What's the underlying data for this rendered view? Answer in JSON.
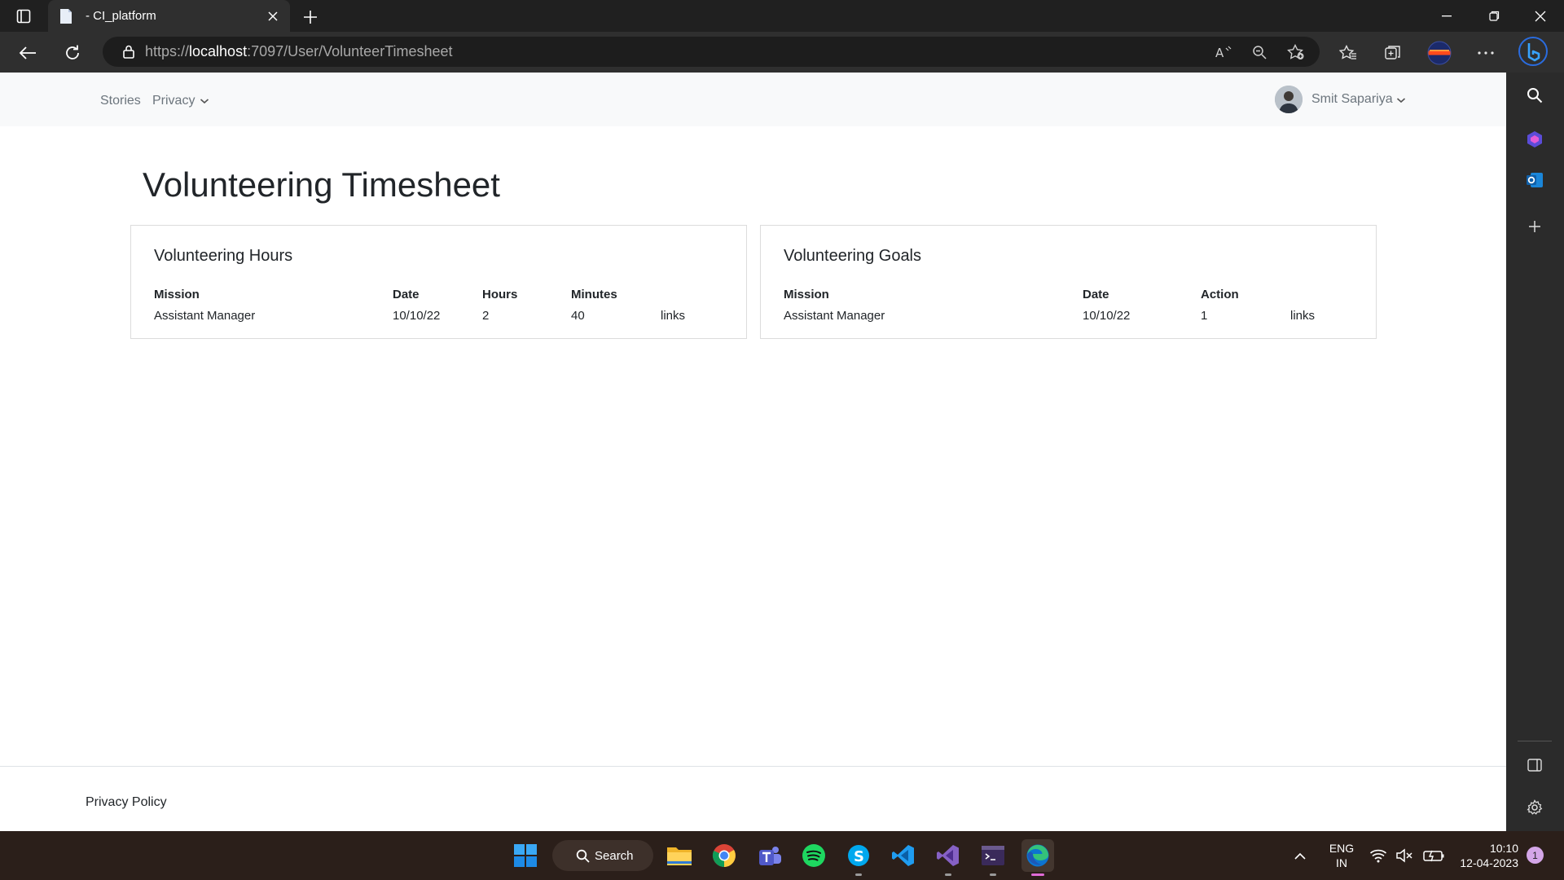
{
  "browser": {
    "tab_title": "- CI_platform",
    "url_prefix": "https://",
    "url_host": "localhost",
    "url_rest": ":7097/User/VolunteerTimesheet"
  },
  "nav": {
    "stories": "Stories",
    "privacy": "Privacy",
    "user_name": "Smit Sapariya"
  },
  "page": {
    "title": "Volunteering Timesheet"
  },
  "hours_card": {
    "title": "Volunteering Hours",
    "headers": [
      "Mission",
      "Date",
      "Hours",
      "Minutes"
    ],
    "rows": [
      {
        "mission": "Assistant Manager",
        "date": "10/10/22",
        "hours": "2",
        "minutes": "40",
        "link": "links"
      }
    ]
  },
  "goals_card": {
    "title": "Volunteering Goals",
    "headers": [
      "Mission",
      "Date",
      "Action"
    ],
    "rows": [
      {
        "mission": "Assistant Manager",
        "date": "10/10/22",
        "action": "1",
        "link": "links"
      }
    ]
  },
  "footer": {
    "privacy_policy": "Privacy Policy"
  },
  "taskbar": {
    "search_label": "Search",
    "lang_top": "ENG",
    "lang_bottom": "IN",
    "time": "10:10",
    "date": "12-04-2023",
    "notification_count": "1"
  },
  "colors": {
    "browser_dark": "#202020",
    "nav_bg": "#f8f9fa",
    "muted_text": "#6c757d",
    "taskbar": "#2b1f1a"
  }
}
